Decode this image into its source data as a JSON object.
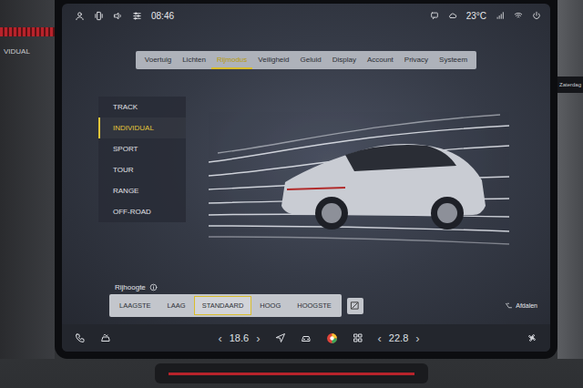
{
  "side_left": {
    "text": "VIDUAL"
  },
  "side_right": {
    "text": "Zaterdag"
  },
  "status_bar": {
    "time": "08:46",
    "temperature": "23°C"
  },
  "tabs": [
    {
      "label": "Voertuig",
      "selected": false
    },
    {
      "label": "Lichten",
      "selected": false
    },
    {
      "label": "Rijmodus",
      "selected": true
    },
    {
      "label": "Veiligheid",
      "selected": false
    },
    {
      "label": "Geluid",
      "selected": false
    },
    {
      "label": "Display",
      "selected": false
    },
    {
      "label": "Account",
      "selected": false
    },
    {
      "label": "Privacy",
      "selected": false
    },
    {
      "label": "Systeem",
      "selected": false
    }
  ],
  "drive_modes": [
    {
      "label": "TRACK",
      "selected": false
    },
    {
      "label": "INDIVIDUAL",
      "selected": true
    },
    {
      "label": "SPORT",
      "selected": false
    },
    {
      "label": "TOUR",
      "selected": false
    },
    {
      "label": "RANGE",
      "selected": false
    },
    {
      "label": "OFF-ROAD",
      "selected": false
    }
  ],
  "ride_height": {
    "label": "Rijhoogte",
    "options": [
      {
        "label": "LAAGSTE",
        "selected": false
      },
      {
        "label": "LAAG",
        "selected": false
      },
      {
        "label": "STANDAARD",
        "selected": true
      },
      {
        "label": "HOOG",
        "selected": false
      },
      {
        "label": "HOOGSTE",
        "selected": false
      }
    ]
  },
  "descent": {
    "label": "Afdalen"
  },
  "climate": {
    "left": {
      "down": "‹",
      "value": "18.6",
      "up": "›"
    },
    "right": {
      "down": "‹",
      "value": "22.8",
      "up": "›"
    }
  }
}
